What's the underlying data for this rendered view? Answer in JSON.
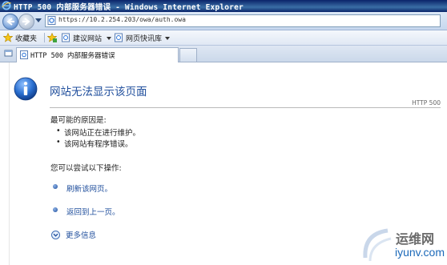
{
  "window": {
    "title": "HTTP 500 内部服务器错误 - Windows Internet Explorer"
  },
  "address_bar": {
    "url": "https://10.2.254.203/owa/auth.owa"
  },
  "favorites_bar": {
    "favorites_label": "收藏夹",
    "suggested_sites_label": "建议网站",
    "web_slice_gallery_label": "网页快讯库"
  },
  "tabs": [
    {
      "label": "HTTP 500 内部服务器错误"
    }
  ],
  "error_page": {
    "heading": "网站无法显示该页面",
    "error_code": "HTTP 500",
    "reasons_title": "最可能的原因是:",
    "reasons": [
      "该网站正在进行维护。",
      "该网站有程序错误。"
    ],
    "try_title": "您可以尝试以下操作:",
    "actions": [
      {
        "label": "刷新该网页。"
      },
      {
        "label": "返回到上一页。"
      }
    ],
    "more_info_label": "更多信息"
  },
  "watermark": {
    "cn": "运维网",
    "en": "iyunv.com"
  },
  "colors": {
    "title_bar": "#0a246a",
    "link": "#1f4e9c",
    "info_icon": "#1e5bb8"
  }
}
